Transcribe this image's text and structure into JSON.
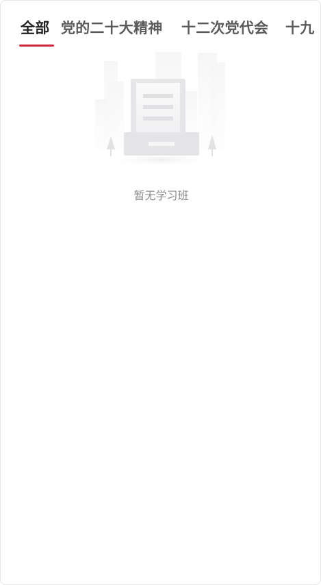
{
  "tabs": [
    {
      "label": "全部",
      "active": true
    },
    {
      "label": "党的二十大精神",
      "active": false
    },
    {
      "label": "十二次党代会",
      "active": false
    },
    {
      "label": "十九",
      "active": false
    }
  ],
  "empty_state": {
    "icon": "empty-document-icon",
    "message": "暂无学习班"
  },
  "colors": {
    "accent": "#d1233a",
    "active_tab_text": "#222222",
    "inactive_tab_text": "#5a5a5a",
    "empty_text": "#8c8c8c"
  }
}
